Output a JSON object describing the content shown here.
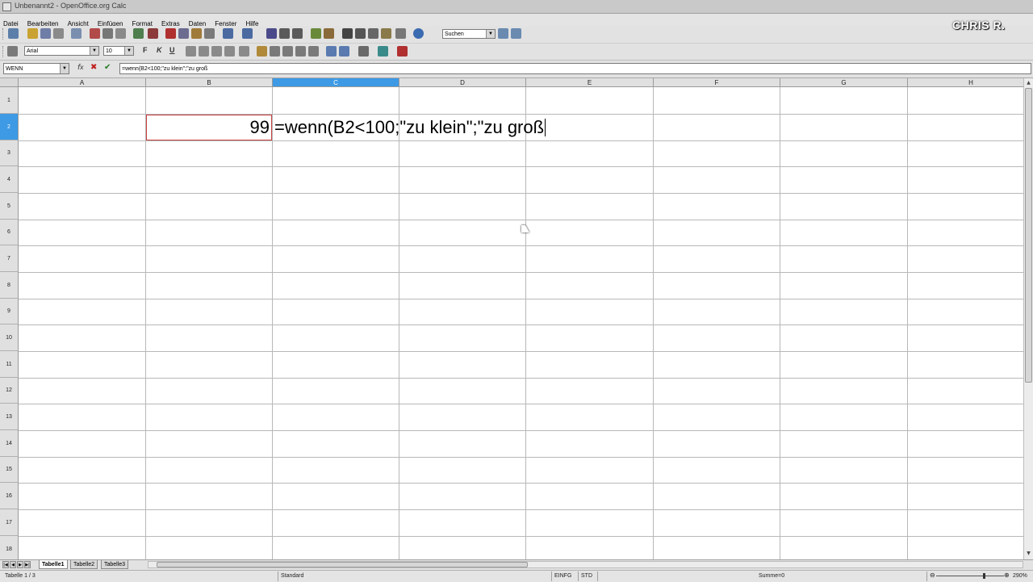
{
  "window": {
    "title": "Unbenannt2 - OpenOffice.org Calc",
    "watermark": "CHRIS R."
  },
  "menu": [
    "Datei",
    "Bearbeiten",
    "Ansicht",
    "Einfügen",
    "Format",
    "Extras",
    "Daten",
    "Fenster",
    "Hilfe"
  ],
  "toolbar": {
    "search_placeholder": "Suchen",
    "font_name": "Arial",
    "font_size": "10",
    "bold_label": "F",
    "italic_label": "K",
    "underline_label": "U"
  },
  "formula_bar": {
    "name_box": "WENN",
    "formula": "=wenn(B2<100;\"zu klein\";\"zu groß"
  },
  "columns": [
    "A",
    "B",
    "C",
    "D",
    "E",
    "F",
    "G",
    "H"
  ],
  "rows": [
    "1",
    "2",
    "3",
    "4",
    "5",
    "6",
    "7",
    "8",
    "9",
    "10",
    "11",
    "12",
    "13",
    "14",
    "15",
    "16",
    "17",
    "18"
  ],
  "cells": {
    "B2": "99",
    "C2_edit": "=wenn(B2<100;\"zu klein\";\"zu groß"
  },
  "sheets": [
    "Tabelle1",
    "Tabelle2",
    "Tabelle3"
  ],
  "status": {
    "sheet": "Tabelle 1 / 3",
    "style": "Standard",
    "insert_mode": "EINFG",
    "selection_mode": "STD",
    "sum": "Summe=0",
    "zoom": "290%"
  },
  "colors": {
    "header_active": "#3e9ae4",
    "cell_border_ref": "#c84040"
  }
}
